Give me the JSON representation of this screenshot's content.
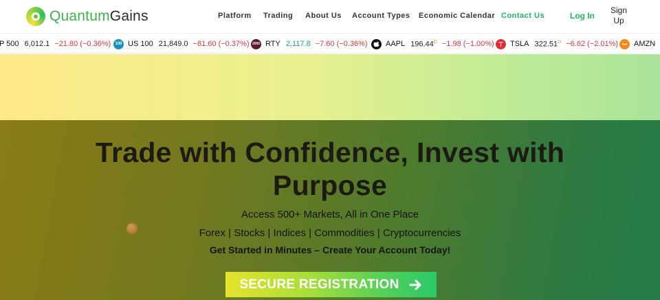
{
  "brand": {
    "name_part1": "Quantum",
    "name_part2": "Gains",
    "logo_icon": "quantumgains-logo-icon",
    "colors": {
      "primary_green": "#22b561",
      "accent_yellow": "#e6e32c"
    }
  },
  "nav": {
    "items": [
      {
        "label": "Platform",
        "active": false
      },
      {
        "label": "Trading",
        "active": false
      },
      {
        "label": "About Us",
        "active": false
      },
      {
        "label": "Account Types",
        "active": false
      },
      {
        "label": "Economic Calendar",
        "active": false
      },
      {
        "label": "Contact Us",
        "active": true
      }
    ],
    "login_label": "Log In",
    "signup_line1": "Sign",
    "signup_line2": "Up"
  },
  "ticker": [
    {
      "symbol": "P 500",
      "price": "6,012.1",
      "change": "−21.80 (−0.36%)",
      "icon": "sp500-icon",
      "direction": "down"
    },
    {
      "symbol": "US 100",
      "price": "21,849.0",
      "change": "−81.60 (−0.37%)",
      "icon": "us100-icon",
      "icon_text": "100",
      "direction": "down"
    },
    {
      "symbol": "RTY",
      "price": "2,117.8",
      "change": "−7.60 (−0.36%)",
      "icon": "russell2000-icon",
      "icon_text": "2000",
      "direction": "down"
    },
    {
      "symbol": "AAPL",
      "price": "196.44",
      "price_sup": "D",
      "change": "−1.98 (−1.00%)",
      "icon": "apple-icon",
      "direction": "down"
    },
    {
      "symbol": "TSLA",
      "price": "322.51",
      "price_sup": "D",
      "change": "−6.62 (−2.01%)",
      "icon": "tesla-icon",
      "direction": "down"
    },
    {
      "symbol": "AMZN",
      "price": "",
      "change": "",
      "icon": "amazon-icon",
      "direction": "down"
    }
  ],
  "hero": {
    "title": "Trade with Confidence, Invest with Purpose",
    "subtitle": "Access 500+ Markets, All in One Place",
    "markets": "Forex | Stocks | Indices | Commodities | Cryptocurrencies",
    "tagline": "Get Started in Minutes – Create Your Account Today!",
    "cta_label": "SECURE REGISTRATION",
    "cta_icon": "arrow-right-icon"
  }
}
